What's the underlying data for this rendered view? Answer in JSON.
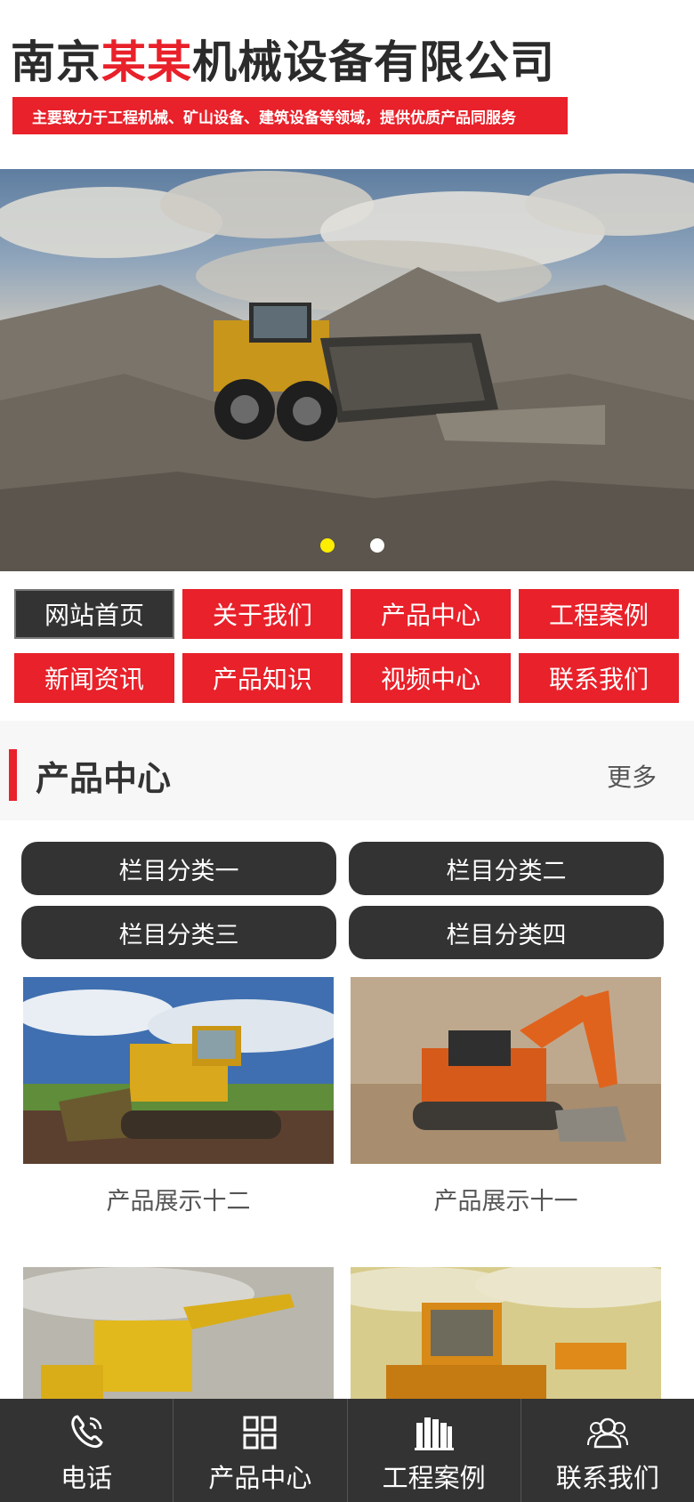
{
  "header": {
    "title_part1": "南京",
    "title_accent": "某某",
    "title_part2": "机械设备有限公司",
    "slogan": "主要致力于工程机械、矿山设备、建筑设备等领域，提供优质产品同服务"
  },
  "banner": {
    "slides": 2,
    "active_slide": 1
  },
  "nav": [
    {
      "label": "网站首页",
      "active": true
    },
    {
      "label": "关于我们",
      "active": false
    },
    {
      "label": "产品中心",
      "active": false
    },
    {
      "label": "工程案例",
      "active": false
    },
    {
      "label": "新闻资讯",
      "active": false
    },
    {
      "label": "产品知识",
      "active": false
    },
    {
      "label": "视频中心",
      "active": false
    },
    {
      "label": "联系我们",
      "active": false
    }
  ],
  "section": {
    "title": "产品中心",
    "more": "更多"
  },
  "categories": [
    "栏目分类一",
    "栏目分类二",
    "栏目分类三",
    "栏目分类四"
  ],
  "products": [
    {
      "name": "产品展示十二"
    },
    {
      "name": "产品展示十一"
    },
    {
      "name": ""
    },
    {
      "name": ""
    }
  ],
  "footer": [
    {
      "label": "电话",
      "icon": "phone-icon"
    },
    {
      "label": "产品中心",
      "icon": "grid-icon"
    },
    {
      "label": "工程案例",
      "icon": "books-icon"
    },
    {
      "label": "联系我们",
      "icon": "users-icon"
    }
  ],
  "colors": {
    "accent": "#e8212a",
    "dark": "#333333",
    "dot_active": "#ffed00"
  }
}
